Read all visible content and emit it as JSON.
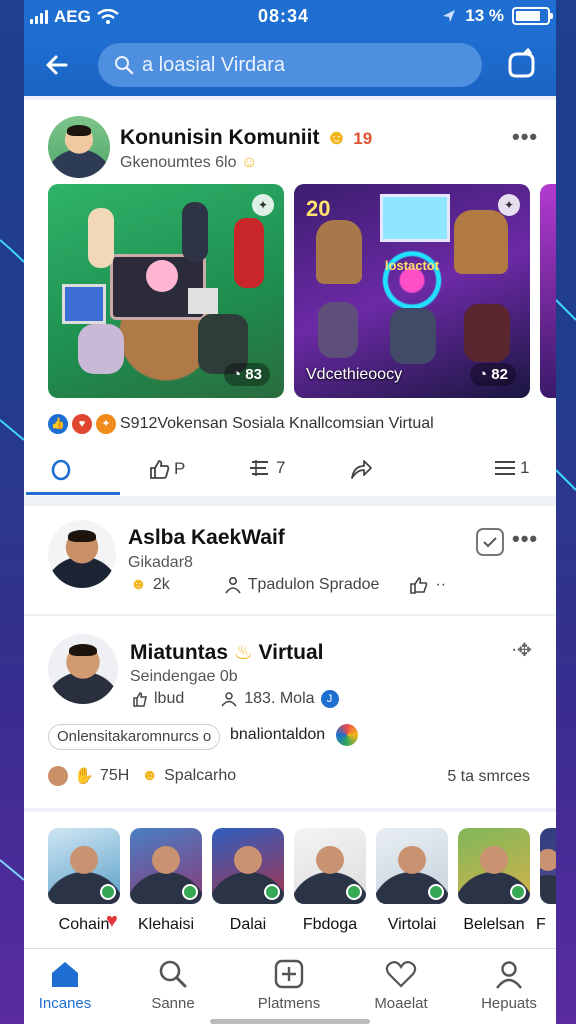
{
  "status_bar": {
    "carrier": "AEG",
    "time": "08:34",
    "battery_text": "13 %"
  },
  "header": {
    "search_placeholder": "a loasial Virdara"
  },
  "post1": {
    "title": "Konunisin Komuniit",
    "title_suffix": "19",
    "subtitle": "Gkenoumtes 6lo",
    "media1_badge": "◔ 83",
    "media2_caption": "Vdcethieoocy",
    "media2_badge": "◔ 82",
    "media2_counter": "20",
    "media2_screen_text": "lostactot",
    "reactions_text": "S912Vokensan Sosiala Knallcomsian Virtual",
    "actions": {
      "like_count": "",
      "share_count": "P",
      "list_count": "7",
      "menu_count": "1"
    }
  },
  "post2": {
    "title": "Aslba KaekWaif",
    "subtitle": "Gikadar8",
    "stat1": "2k",
    "stat2": "Tpadulon Spradoe",
    "stat3": "··"
  },
  "post3": {
    "title": "Miatuntas",
    "title_suffix": "Virtual",
    "subtitle": "Seindengae 0b",
    "stat1": "lbud",
    "stat2": "183. Mola",
    "pill_text": "Onlensitakaromnurcs o",
    "pill_after": "bnaliontaldon",
    "footer_left": "75H",
    "footer_mid": "Spalcarho",
    "footer_right": "5 ta smrces"
  },
  "stories": [
    {
      "label": "Cohain",
      "colors": [
        "#cfe6f3",
        "#5aa0c8"
      ]
    },
    {
      "label": "Klehaisi",
      "colors": [
        "#4a7fc4",
        "#8a3a78"
      ]
    },
    {
      "label": "Dalai",
      "colors": [
        "#2e5fbf",
        "#a8344f"
      ]
    },
    {
      "label": "Fbdoga",
      "colors": [
        "#f4f4f4",
        "#dcdcdc"
      ]
    },
    {
      "label": "Virtolai",
      "colors": [
        "#e8eef3",
        "#c7d2dc"
      ]
    },
    {
      "label": "Belelsan",
      "colors": [
        "#7fb85a",
        "#d6b04a"
      ]
    },
    {
      "label": "F",
      "colors": [
        "#2d3d7a",
        "#5a4a9a"
      ]
    }
  ],
  "bottom_nav": [
    {
      "label": "Incanes",
      "icon": "home-icon",
      "active": true
    },
    {
      "label": "Sanne",
      "icon": "search-icon",
      "active": false
    },
    {
      "label": "Platmens",
      "icon": "add-box-icon",
      "active": false
    },
    {
      "label": "Moaelat",
      "icon": "heart-icon",
      "active": false
    },
    {
      "label": "Hepuats",
      "icon": "profile-icon",
      "active": false
    }
  ],
  "colors": {
    "primary": "#1e6fd1",
    "background_top": "#1f3f8f",
    "background_bottom": "#5a2aa0"
  }
}
